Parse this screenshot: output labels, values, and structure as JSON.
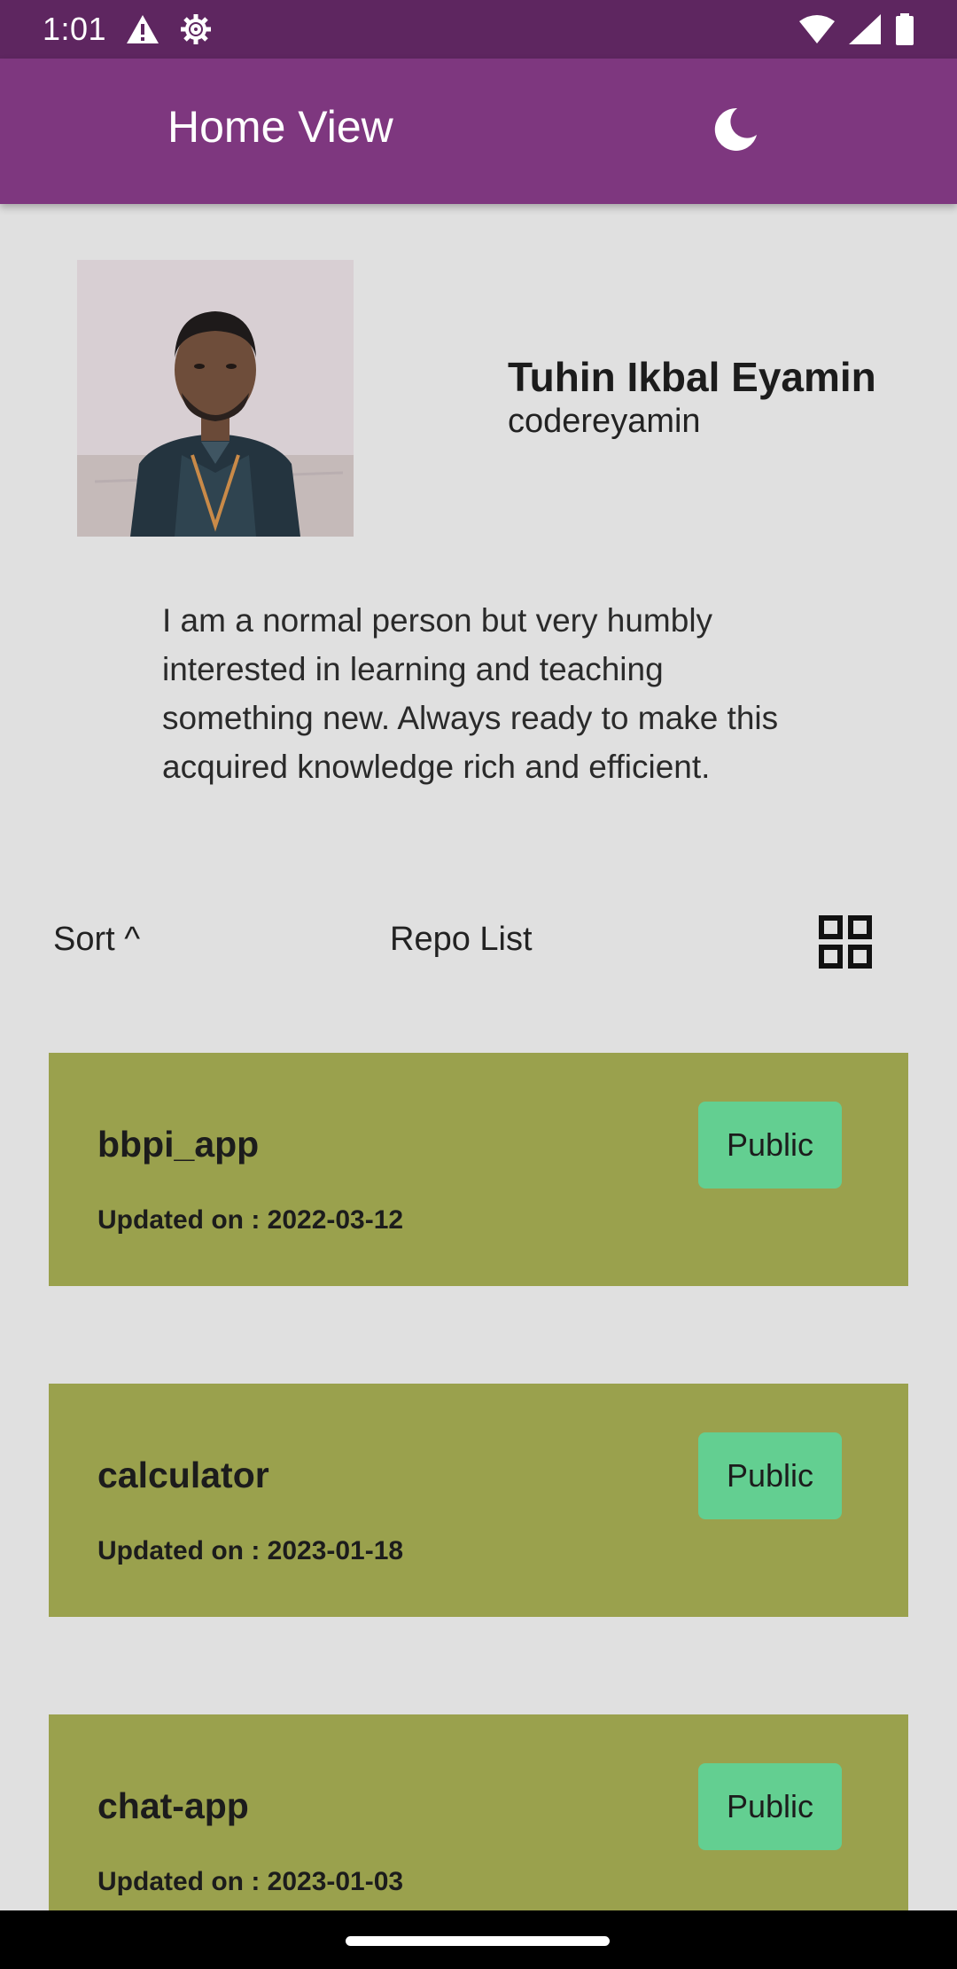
{
  "status_bar": {
    "time": "1:01",
    "icons_left": [
      "warning-icon",
      "settings-gear-icon"
    ],
    "icons_right": [
      "wifi-icon",
      "signal-icon",
      "battery-icon"
    ]
  },
  "app_bar": {
    "title": "Home View",
    "theme_icon": "moon-icon",
    "background": "#7e377f"
  },
  "profile": {
    "name": "Tuhin Ikbal Eyamin",
    "username": "codereyamin",
    "bio": "I am a normal person but very humbly interested in learning and teaching something new. Always ready to make this acquired knowledge rich and efficient."
  },
  "toolbar": {
    "sort_label": "Sort ^",
    "list_title": "Repo List",
    "view_icon": "grid-view-icon"
  },
  "repos": [
    {
      "name": "bbpi_app",
      "visibility": "Public",
      "updated": "Updated on : 2022-03-12"
    },
    {
      "name": "calculator",
      "visibility": "Public",
      "updated": "Updated on : 2023-01-18"
    },
    {
      "name": "chat-app",
      "visibility": "Public",
      "updated": "Updated on : 2023-01-03"
    }
  ],
  "colors": {
    "card": "#9aa14d",
    "badge": "#63cf91",
    "status_bar": "#5e2660"
  }
}
